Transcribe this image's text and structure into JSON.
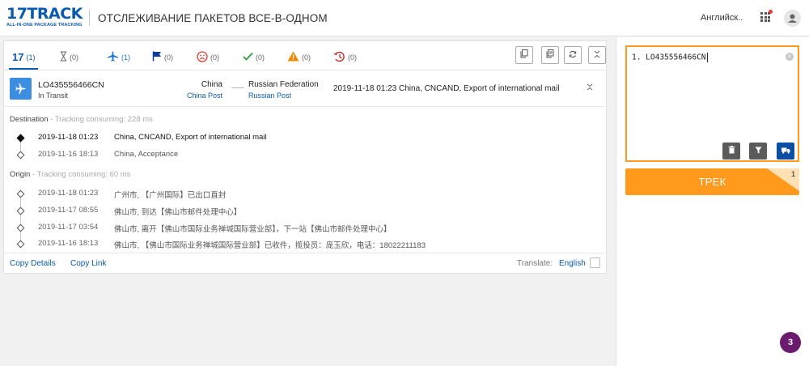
{
  "header": {
    "logo_main": "17TRACK",
    "logo_sub": "ALL-IN-ONE PACKAGE TRACKING",
    "title": "ОТСЛЕЖИВАНИЕ ПАКЕТОВ ВСЕ-В-ОДНОМ",
    "language": "Английск..",
    "apps_icon": "apps-grid-icon",
    "user_icon": "user-icon"
  },
  "tabs": [
    {
      "label": "17",
      "count": "(1)",
      "icon": "all-icon",
      "color": "#0a5bb0"
    },
    {
      "label": "",
      "count": "(0)",
      "icon": "hourglass-icon",
      "color": "#666666"
    },
    {
      "label": "",
      "count": "(1)",
      "icon": "plane-icon",
      "color": "#1e74d6"
    },
    {
      "label": "",
      "count": "(0)",
      "icon": "flag-icon",
      "color": "#0a3fa0"
    },
    {
      "label": "",
      "count": "(0)",
      "icon": "sad-face-icon",
      "color": "#e53935"
    },
    {
      "label": "",
      "count": "(0)",
      "icon": "check-icon",
      "color": "#2e9b3a"
    },
    {
      "label": "",
      "count": "(0)",
      "icon": "warning-icon",
      "color": "#f08a00"
    },
    {
      "label": "",
      "count": "(0)",
      "icon": "expired-clock-icon",
      "color": "#c62828"
    }
  ],
  "package": {
    "number": "LO435556466CN",
    "status": "In Transit",
    "origin_country": "China",
    "origin_carrier": "China Post",
    "destination_country": "Russian Federation",
    "destination_carrier": "Russian Post",
    "latest_time": "2019-11-18 01:23",
    "latest_event": "China, CNCAND, Export of international mail"
  },
  "destination_section": {
    "label": "Destination",
    "consuming": "Tracking consuming: 228 ms",
    "events": [
      {
        "time": "2019-11-18 01:23",
        "desc": "China, CNCAND, Export of international mail"
      },
      {
        "time": "2019-11-16 18:13",
        "desc": "China, Acceptance"
      }
    ]
  },
  "origin_section": {
    "label": "Origin",
    "consuming": "Tracking consuming: 60 ms",
    "events": [
      {
        "time": "2019-11-18 01:23",
        "desc": "广州市, 【广州国际】已出口直封"
      },
      {
        "time": "2019-11-17 08:55",
        "desc": "佛山市, 到达【佛山市邮件处理中心】"
      },
      {
        "time": "2019-11-17 03:54",
        "desc": "佛山市, 离开【佛山市国际业务禅城国际营业部】，下一站【佛山市邮件处理中心】"
      },
      {
        "time": "2019-11-16 18:13",
        "desc": "佛山市, 【佛山市国际业务禅城国际营业部】已收件，揽投员：庞玉欣，电话：18022211183"
      }
    ]
  },
  "footer": {
    "copy_details": "Copy Details",
    "copy_link": "Copy Link",
    "translate_label": "Translate:",
    "translate_lang": "English"
  },
  "input_panel": {
    "text": "1. LO435556466CN",
    "track_label": "ТРЕК",
    "track_count": "1"
  },
  "badge": "3",
  "colors": {
    "brand": "#0a5bb0",
    "accent": "#ff9a1c",
    "badge": "#6a1b6e"
  }
}
